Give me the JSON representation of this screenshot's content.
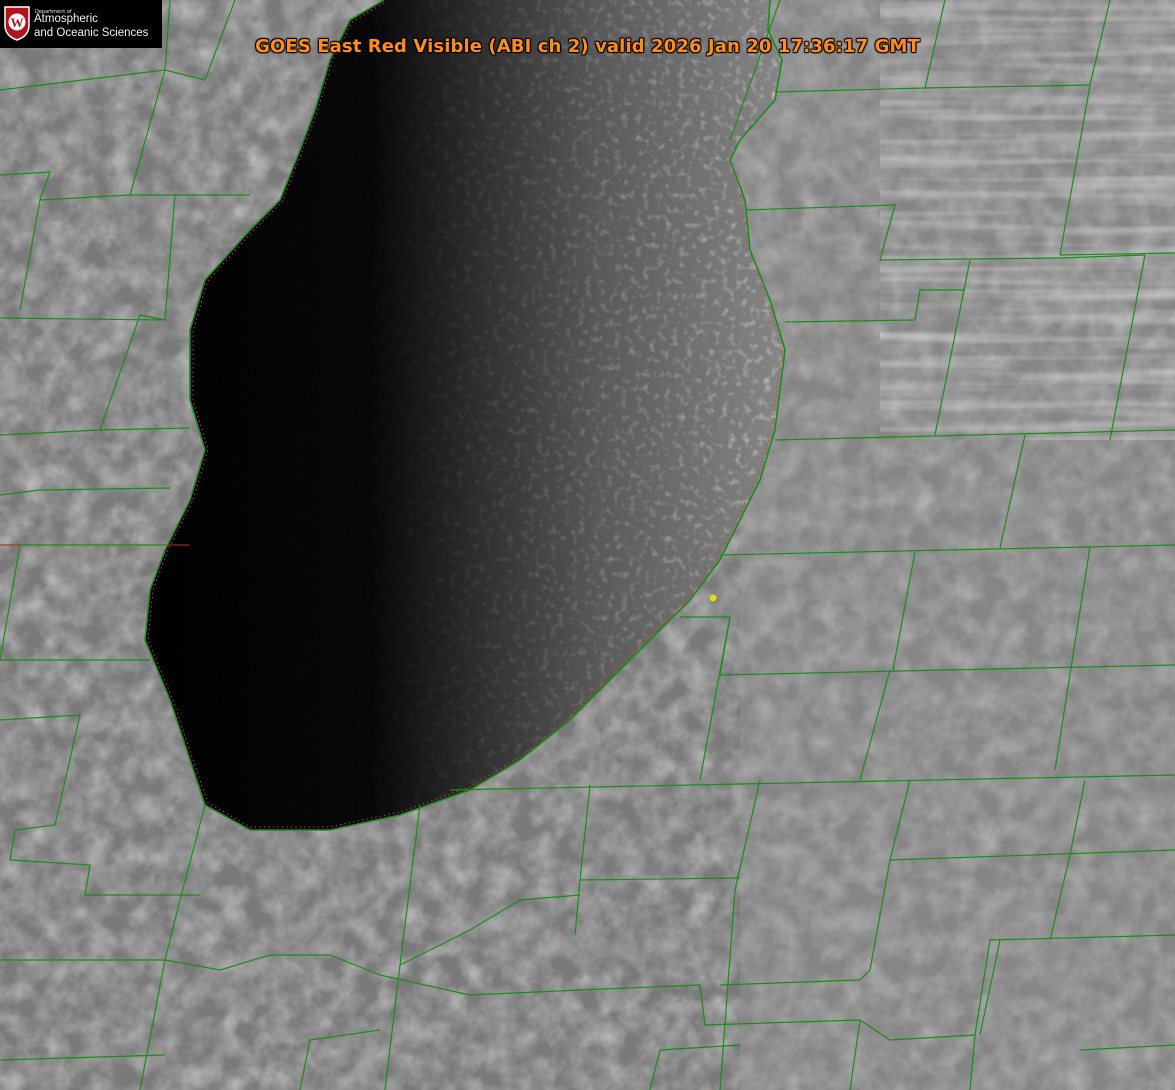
{
  "header": {
    "title": "GOES East Red Visible (ABI ch 2) valid 2026 Jan 20 17:36:17 GMT"
  },
  "logo": {
    "line_small": "Department of",
    "line1": "Atmospheric",
    "line2": "and Oceanic Sciences",
    "seal_letter": "W"
  },
  "colors": {
    "title": "#ff8c1a",
    "county_lines": "#1a8c1a",
    "shoreline_dots": "#d23c3c",
    "marker": "#e0e000",
    "seal": "#b5121b",
    "lake": "#060606",
    "land": "#7b7b7b"
  },
  "icons": {
    "marker": "location-dot-icon",
    "seal": "university-seal-icon"
  }
}
